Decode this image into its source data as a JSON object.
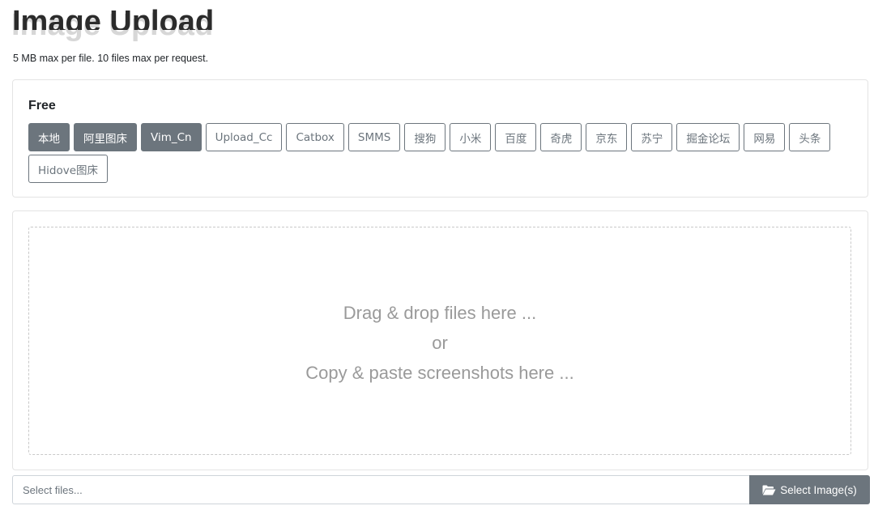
{
  "page": {
    "title": "Image Upload",
    "subtitle": "5 MB max per file. 10 files max per request."
  },
  "hosts": {
    "group_label": "Free",
    "items": [
      {
        "label": "本地",
        "active": true
      },
      {
        "label": "阿里图床",
        "active": true
      },
      {
        "label": "Vim_Cn",
        "active": true
      },
      {
        "label": "Upload_Cc",
        "active": false
      },
      {
        "label": "Catbox",
        "active": false
      },
      {
        "label": "SMMS",
        "active": false
      },
      {
        "label": "搜狗",
        "active": false
      },
      {
        "label": "小米",
        "active": false
      },
      {
        "label": "百度",
        "active": false
      },
      {
        "label": "奇虎",
        "active": false
      },
      {
        "label": "京东",
        "active": false
      },
      {
        "label": "苏宁",
        "active": false
      },
      {
        "label": "掘金论坛",
        "active": false
      },
      {
        "label": "网易",
        "active": false
      },
      {
        "label": "头条",
        "active": false
      },
      {
        "label": "Hidove图床",
        "active": false
      }
    ]
  },
  "dropzone": {
    "line1": "Drag & drop files here ...",
    "line2": "or",
    "line3": "Copy & paste screenshots here ..."
  },
  "file_picker": {
    "placeholder": "Select files...",
    "button_label": "Select Image(s)",
    "button_icon": "folder-open-icon"
  },
  "colors": {
    "secondary": "#6c757d",
    "border": "#e4e4e4",
    "dropzone_text": "#9a9a9a"
  }
}
